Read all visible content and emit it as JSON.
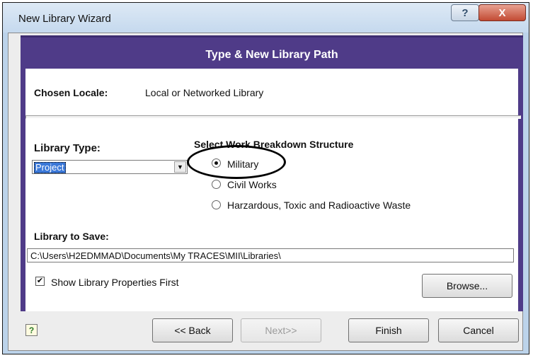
{
  "window": {
    "title": "New Library Wizard",
    "help_label": "?",
    "close_label": "X"
  },
  "banner": {
    "title": "Type & New Library Path"
  },
  "locale": {
    "label": "Chosen Locale:",
    "value": "Local or Networked Library"
  },
  "library_type": {
    "label": "Library Type:",
    "selected": "Project"
  },
  "wbs": {
    "heading": "Select Work Breakdown Structure",
    "options": [
      {
        "label": "Military",
        "checked": true
      },
      {
        "label": "Civil Works",
        "checked": false
      },
      {
        "label": "Harzardous, Toxic and Radioactive Waste",
        "checked": false
      }
    ]
  },
  "save": {
    "label": "Library to Save:",
    "path": "C:\\Users\\H2EDMMAD\\Documents\\My TRACES\\MII\\Libraries\\"
  },
  "show_props": {
    "label": "Show Library Properties First",
    "checked": true
  },
  "buttons": {
    "browse": "Browse...",
    "back": "<< Back",
    "next": "Next>>",
    "finish": "Finish",
    "cancel": "Cancel"
  },
  "icons": {
    "help": "help-icon",
    "dropdown": "chevron-down-icon",
    "check": "check-icon"
  }
}
